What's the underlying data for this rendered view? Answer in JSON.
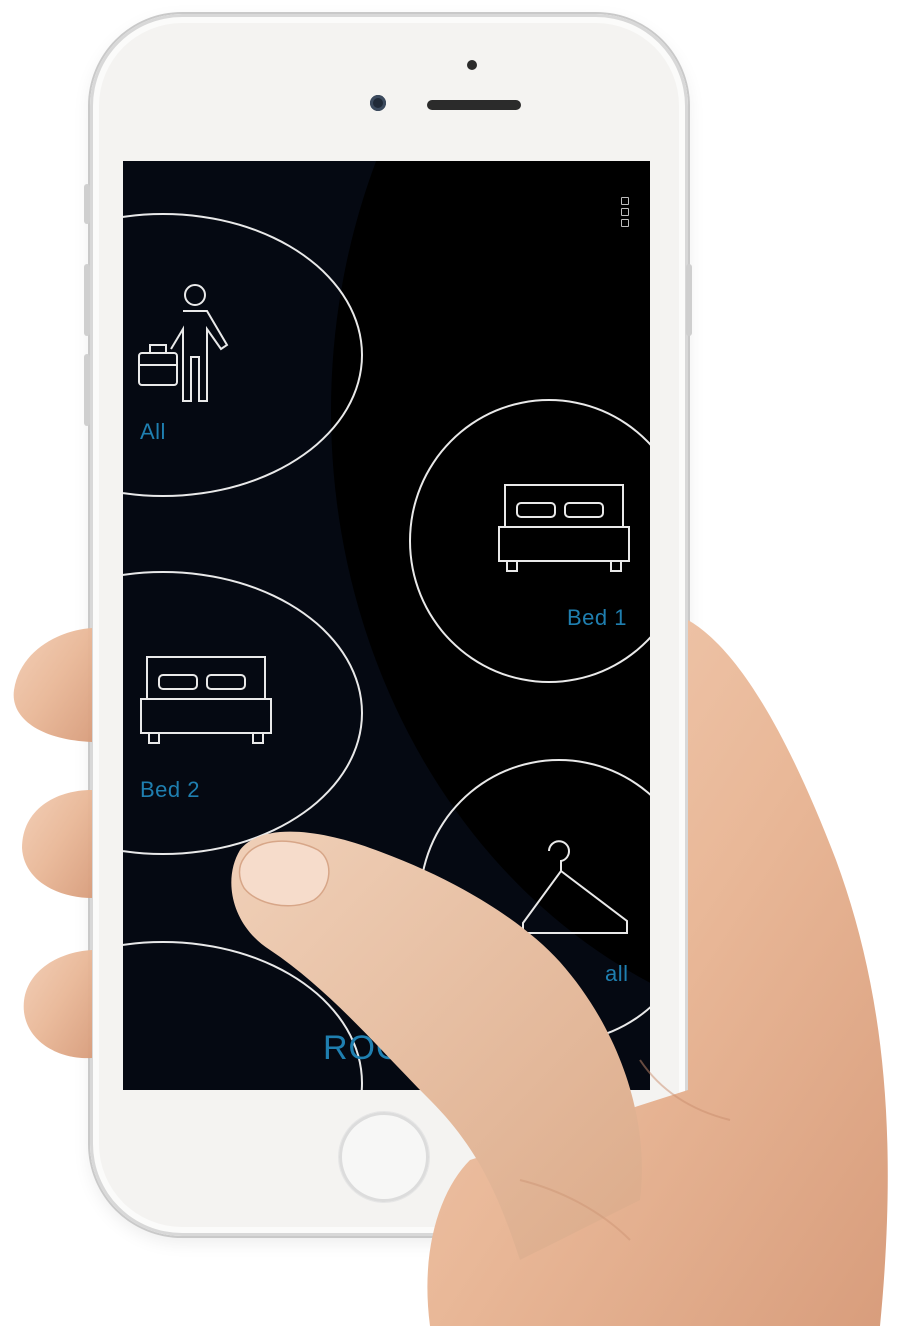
{
  "app": {
    "menu_icon": "more-vertical-icon",
    "tiles": [
      {
        "label": "All",
        "icon": "businessman-icon"
      },
      {
        "label": "Bed 1",
        "icon": "bed-icon"
      },
      {
        "label": "Bed 2",
        "icon": "bed-icon"
      },
      {
        "label": "all",
        "icon": "hanger-icon"
      }
    ],
    "footer_label": "ROOM"
  },
  "colors": {
    "screen_bg": "#050912",
    "accent": "#1f7fb0",
    "outline": "#e9e9e9"
  }
}
